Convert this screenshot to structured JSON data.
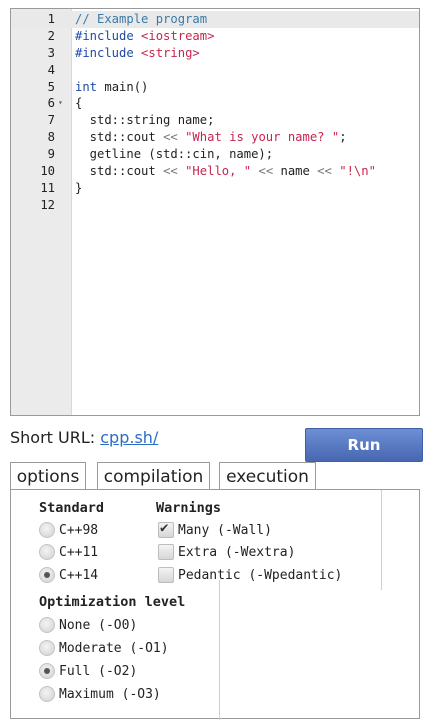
{
  "editor": {
    "lines": [
      {
        "num": "1",
        "tokens": [
          {
            "t": "// Example program",
            "c": "comment"
          }
        ]
      },
      {
        "num": "2",
        "tokens": [
          {
            "t": "#include ",
            "c": "pp"
          },
          {
            "t": "<iostream>",
            "c": "str"
          }
        ]
      },
      {
        "num": "3",
        "tokens": [
          {
            "t": "#include ",
            "c": "pp"
          },
          {
            "t": "<string>",
            "c": "str"
          }
        ]
      },
      {
        "num": "4",
        "tokens": []
      },
      {
        "num": "5",
        "tokens": [
          {
            "t": "int",
            "c": "kw"
          },
          {
            "t": " main()",
            "c": "id"
          }
        ]
      },
      {
        "num": "6",
        "fold": "▾",
        "tokens": [
          {
            "t": "{",
            "c": "id"
          }
        ]
      },
      {
        "num": "7",
        "tokens": [
          {
            "t": "  std::string name;",
            "c": "id"
          }
        ]
      },
      {
        "num": "8",
        "tokens": [
          {
            "t": "  std::cout ",
            "c": "id"
          },
          {
            "t": "<<",
            "c": "op"
          },
          {
            "t": " ",
            "c": "id"
          },
          {
            "t": "\"What is your name? \"",
            "c": "str"
          },
          {
            "t": ";",
            "c": "id"
          }
        ]
      },
      {
        "num": "9",
        "tokens": [
          {
            "t": "  getline (std::cin, name);",
            "c": "id"
          }
        ]
      },
      {
        "num": "10",
        "tokens": [
          {
            "t": "  std::cout ",
            "c": "id"
          },
          {
            "t": "<<",
            "c": "op"
          },
          {
            "t": " ",
            "c": "id"
          },
          {
            "t": "\"Hello, \"",
            "c": "str"
          },
          {
            "t": " ",
            "c": "id"
          },
          {
            "t": "<<",
            "c": "op"
          },
          {
            "t": " name ",
            "c": "id"
          },
          {
            "t": "<<",
            "c": "op"
          },
          {
            "t": " ",
            "c": "id"
          },
          {
            "t": "\"!\\n\"",
            "c": "str"
          }
        ]
      },
      {
        "num": "11",
        "tokens": [
          {
            "t": "}",
            "c": "id"
          }
        ]
      },
      {
        "num": "12",
        "tokens": []
      }
    ]
  },
  "shorturl": {
    "label": "Short URL: ",
    "link": "cpp.sh/"
  },
  "run_label": "Run",
  "tabs": [
    "options",
    "compilation",
    "execution"
  ],
  "options": {
    "standard": {
      "heading": "Standard",
      "items": [
        {
          "label": "C++98",
          "checked": false
        },
        {
          "label": "C++11",
          "checked": false
        },
        {
          "label": "C++14",
          "checked": true
        }
      ]
    },
    "warnings": {
      "heading": "Warnings",
      "items": [
        {
          "label": "Many (-Wall)",
          "checked": true
        },
        {
          "label": "Extra (-Wextra)",
          "checked": false
        },
        {
          "label": "Pedantic (-Wpedantic)",
          "checked": false
        }
      ]
    },
    "optimization": {
      "heading": "Optimization level",
      "items": [
        {
          "label": "None (-O0)",
          "checked": false
        },
        {
          "label": "Moderate (-O1)",
          "checked": false
        },
        {
          "label": "Full (-O2)",
          "checked": true
        },
        {
          "label": "Maximum (-O3)",
          "checked": false
        }
      ]
    }
  }
}
